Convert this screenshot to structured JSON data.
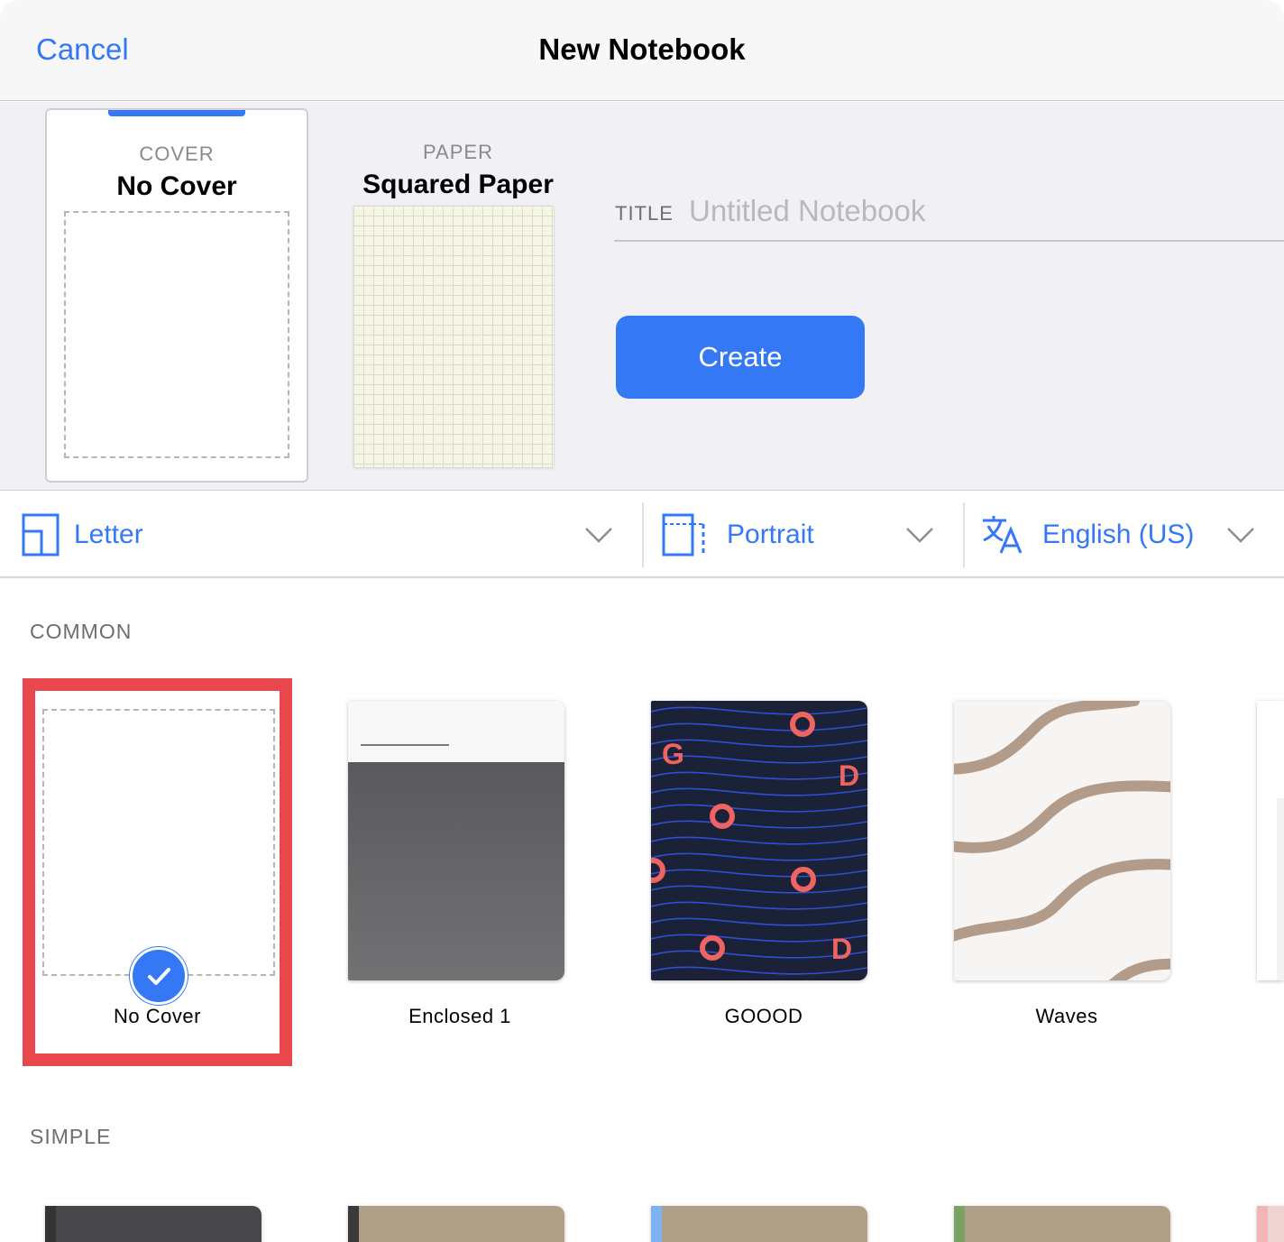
{
  "header": {
    "cancel_label": "Cancel",
    "title": "New Notebook"
  },
  "cover": {
    "kicker": "COVER",
    "value": "No Cover"
  },
  "paper": {
    "kicker": "PAPER",
    "value": "Squared Paper"
  },
  "title_field": {
    "label": "TITLE",
    "placeholder": "Untitled Notebook",
    "value": ""
  },
  "create_label": "Create",
  "options": {
    "size": {
      "label": "Letter",
      "icon": "page-size-icon"
    },
    "orientation": {
      "label": "Portrait",
      "icon": "orientation-icon"
    },
    "language": {
      "label": "English (US)",
      "icon": "translate-icon"
    }
  },
  "sections": {
    "common": {
      "label": "COMMON",
      "items": [
        {
          "name": "No Cover",
          "selected": true
        },
        {
          "name": "Enclosed 1"
        },
        {
          "name": "GOOOD"
        },
        {
          "name": "Waves"
        }
      ]
    },
    "simple": {
      "label": "SIMPLE"
    }
  },
  "colors": {
    "accent": "#3478f6",
    "highlight": "#e8474d",
    "goood_bg": "#1b2238",
    "goood_letters": "#ef6360",
    "goood_lines": "#2f4fd1",
    "waves_stroke": "#b39b8a"
  }
}
